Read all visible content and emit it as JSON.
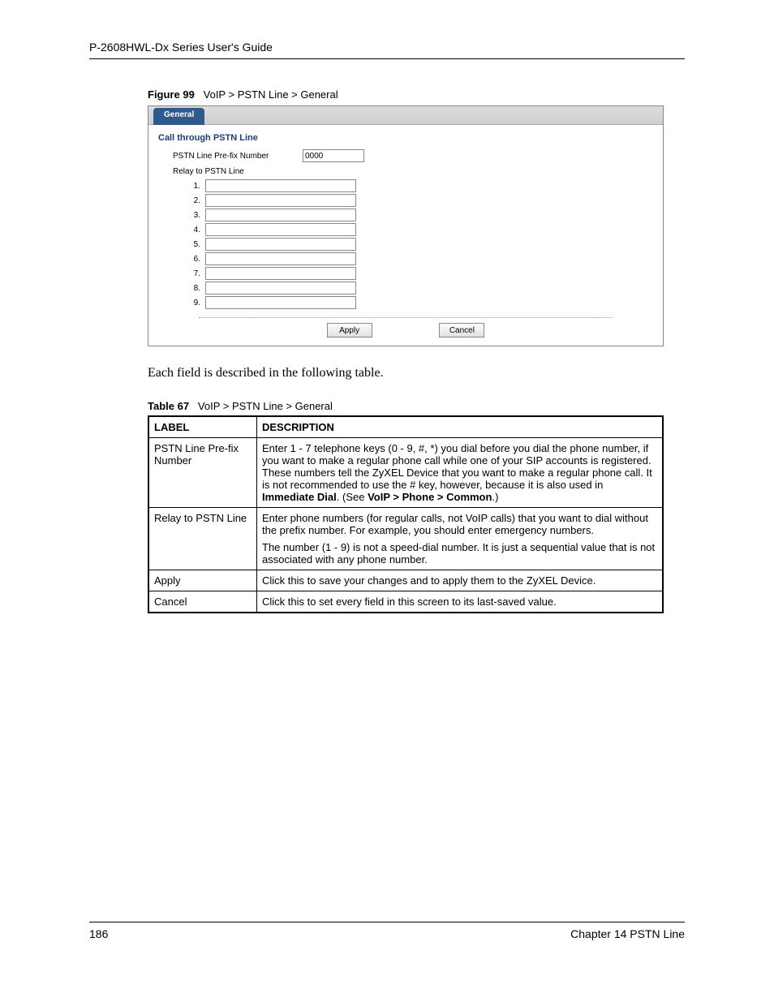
{
  "header": {
    "guide_title": "P-2608HWL-Dx Series User's Guide"
  },
  "figure": {
    "label": "Figure 99",
    "path": "VoIP > PSTN Line > General"
  },
  "router": {
    "tab_label": "General",
    "section_title": "Call through PSTN Line",
    "prefix_label": "PSTN Line Pre-fix Number",
    "prefix_value": "0000",
    "relay_label": "Relay to PSTN Line",
    "relay_rows": [
      {
        "n": "1.",
        "v": ""
      },
      {
        "n": "2.",
        "v": ""
      },
      {
        "n": "3.",
        "v": ""
      },
      {
        "n": "4.",
        "v": ""
      },
      {
        "n": "5.",
        "v": ""
      },
      {
        "n": "6.",
        "v": ""
      },
      {
        "n": "7.",
        "v": ""
      },
      {
        "n": "8.",
        "v": ""
      },
      {
        "n": "9.",
        "v": ""
      }
    ],
    "apply_label": "Apply",
    "cancel_label": "Cancel"
  },
  "paragraph": "Each field is described in the following table.",
  "table": {
    "label": "Table 67",
    "path": "VoIP > PSTN Line > General",
    "headers": {
      "label": "LABEL",
      "description": "DESCRIPTION"
    },
    "rows": [
      {
        "label": "PSTN Line Pre-fix Number",
        "desc_pre": "Enter 1 - 7 telephone keys (0 - 9, #, *) you dial before you dial the phone number, if you want to make a regular phone call while one of your SIP accounts is registered. These numbers tell the ZyXEL Device that you want to make a regular phone call. It is not recommended to use the # key, however, because it is also used in ",
        "desc_b1": "Immediate Dial",
        "desc_mid": ". (See ",
        "desc_b2": "VoIP > Phone > Common",
        "desc_post": ".)"
      },
      {
        "label": "Relay to PSTN Line",
        "desc_p1": "Enter phone numbers (for regular calls, not VoIP calls) that you want to dial without the prefix number. For example, you should enter emergency numbers.",
        "desc_p2": "The number (1 - 9) is not a speed-dial number. It is just a sequential value that is not associated with any phone number."
      },
      {
        "label": "Apply",
        "desc_p1": "Click this to save your changes and to apply them to the ZyXEL Device."
      },
      {
        "label": "Cancel",
        "desc_p1": "Click this to set every field in this screen to its last-saved value."
      }
    ]
  },
  "footer": {
    "page": "186",
    "chapter": "Chapter 14 PSTN Line"
  }
}
